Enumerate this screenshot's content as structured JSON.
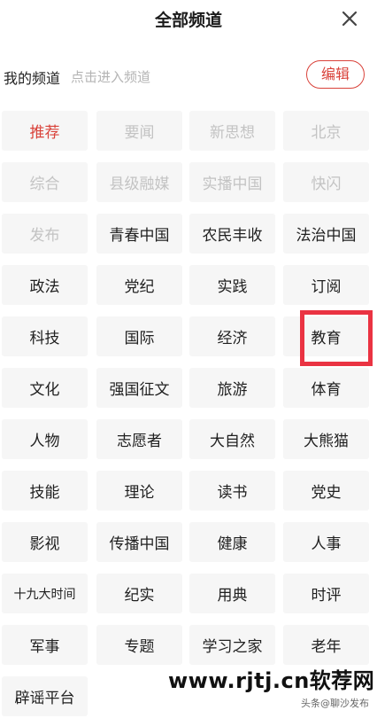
{
  "header": {
    "title": "全部频道",
    "close_icon": "close-icon"
  },
  "my_channels": {
    "label": "我的频道",
    "hint": "点击进入频道",
    "edit_label": "编辑"
  },
  "colors": {
    "accent": "#d9423a",
    "highlight": "#ea3342",
    "fixed_text": "#c3c3c3",
    "cell_bg": "#f6f6f6"
  },
  "channels": [
    {
      "label": "推荐",
      "state": "active"
    },
    {
      "label": "要闻",
      "state": "fixed"
    },
    {
      "label": "新思想",
      "state": "fixed"
    },
    {
      "label": "北京",
      "state": "fixed"
    },
    {
      "label": "综合",
      "state": "fixed"
    },
    {
      "label": "县级融媒",
      "state": "fixed"
    },
    {
      "label": "实播中国",
      "state": "fixed"
    },
    {
      "label": "快闪",
      "state": "fixed"
    },
    {
      "label": "发布",
      "state": "fixed"
    },
    {
      "label": "青春中国",
      "state": "normal"
    },
    {
      "label": "农民丰收",
      "state": "normal"
    },
    {
      "label": "法治中国",
      "state": "normal"
    },
    {
      "label": "政法",
      "state": "normal"
    },
    {
      "label": "党纪",
      "state": "normal"
    },
    {
      "label": "实践",
      "state": "normal"
    },
    {
      "label": "订阅",
      "state": "normal"
    },
    {
      "label": "科技",
      "state": "normal"
    },
    {
      "label": "国际",
      "state": "normal"
    },
    {
      "label": "经济",
      "state": "normal"
    },
    {
      "label": "教育",
      "state": "normal"
    },
    {
      "label": "文化",
      "state": "normal"
    },
    {
      "label": "强国征文",
      "state": "normal"
    },
    {
      "label": "旅游",
      "state": "normal"
    },
    {
      "label": "体育",
      "state": "normal"
    },
    {
      "label": "人物",
      "state": "normal"
    },
    {
      "label": "志愿者",
      "state": "normal"
    },
    {
      "label": "大自然",
      "state": "normal"
    },
    {
      "label": "大熊猫",
      "state": "normal"
    },
    {
      "label": "技能",
      "state": "normal"
    },
    {
      "label": "理论",
      "state": "normal"
    },
    {
      "label": "读书",
      "state": "normal"
    },
    {
      "label": "党史",
      "state": "normal"
    },
    {
      "label": "影视",
      "state": "normal"
    },
    {
      "label": "传播中国",
      "state": "normal"
    },
    {
      "label": "健康",
      "state": "normal"
    },
    {
      "label": "人事",
      "state": "normal"
    },
    {
      "label": "十九大时间",
      "state": "normal"
    },
    {
      "label": "纪实",
      "state": "normal"
    },
    {
      "label": "用典",
      "state": "normal"
    },
    {
      "label": "时评",
      "state": "normal"
    },
    {
      "label": "军事",
      "state": "normal"
    },
    {
      "label": "专题",
      "state": "normal"
    },
    {
      "label": "学习之家",
      "state": "normal"
    },
    {
      "label": "老年",
      "state": "normal"
    },
    {
      "label": "辟谣平台",
      "state": "normal"
    }
  ],
  "watermark": {
    "site": "www.rjtj.cn软荐网",
    "credit": "头条@聊沙发布"
  }
}
